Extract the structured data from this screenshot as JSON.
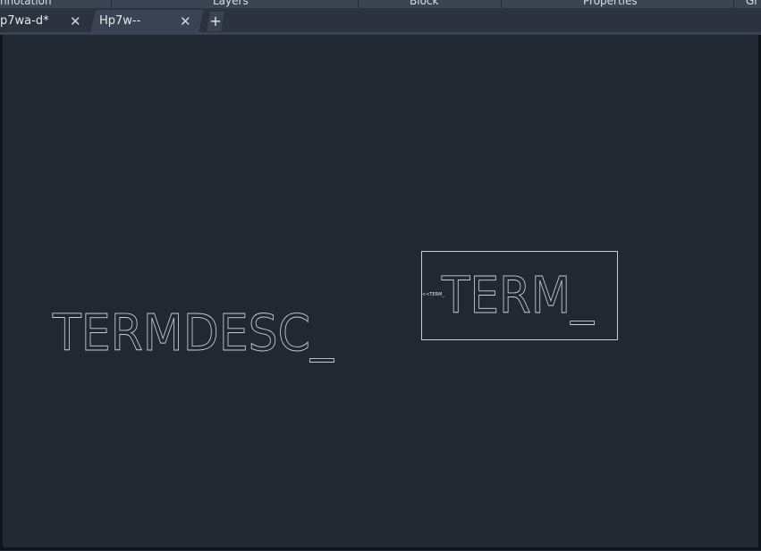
{
  "ribbon": {
    "panels": [
      "nnotation",
      "Layers",
      "Block",
      "Properties",
      "Gr"
    ]
  },
  "tabs": [
    {
      "label": "p7wa-d*",
      "close": "✕"
    },
    {
      "label": "Hp7w--",
      "close": "✕"
    }
  ],
  "new_tab_label": "+",
  "drawing": {
    "left_text": "TERMDESC_",
    "block_text": "TERM_",
    "block_small_label": "<<TERM_"
  }
}
